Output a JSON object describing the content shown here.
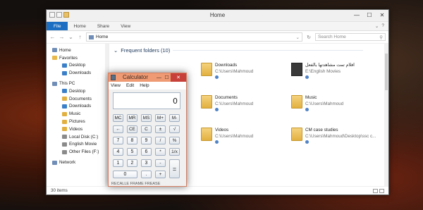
{
  "explorer": {
    "title": "Home",
    "controls": {
      "minimize": "—",
      "maximize": "☐",
      "close": "✕"
    },
    "ribbon_tabs": [
      "File",
      "Home",
      "Share",
      "View"
    ],
    "ribbon_right": {
      "expand": "⌄",
      "help": "?"
    },
    "address": {
      "back": "←",
      "forward": "→",
      "recent": "⌄",
      "up": "↑",
      "path": "Home",
      "dropdown": "⌄",
      "refresh": "↻"
    },
    "search_placeholder": "Search Home",
    "nav": [
      {
        "label": "Home",
        "level": 1,
        "icon": "home-icon",
        "color": "#6f8db7"
      },
      {
        "label": "Favorites",
        "level": 1,
        "icon": "star-icon",
        "color": "#e8b84a"
      },
      {
        "label": "Desktop",
        "level": 2,
        "icon": "desktop-icon",
        "color": "#3a7fc8"
      },
      {
        "label": "Downloads",
        "level": 2,
        "icon": "downloads-icon",
        "color": "#3a7fc8"
      },
      {
        "label": "This PC",
        "level": 1,
        "icon": "computer-icon",
        "color": "#6f8db7"
      },
      {
        "label": "Desktop",
        "level": 2,
        "icon": "desktop-icon",
        "color": "#3a7fc8"
      },
      {
        "label": "Documents",
        "level": 2,
        "icon": "documents-icon",
        "color": "#e2b040"
      },
      {
        "label": "Downloads",
        "level": 2,
        "icon": "downloads-icon",
        "color": "#3a7fc8"
      },
      {
        "label": "Music",
        "level": 2,
        "icon": "music-icon",
        "color": "#e2b040"
      },
      {
        "label": "Pictures",
        "level": 2,
        "icon": "pictures-icon",
        "color": "#e2b040"
      },
      {
        "label": "Videos",
        "level": 2,
        "icon": "videos-icon",
        "color": "#e2b040"
      },
      {
        "label": "Local Disk (C:)",
        "level": 2,
        "icon": "drive-icon",
        "color": "#8a8a8a"
      },
      {
        "label": "English Movie",
        "level": 2,
        "icon": "drive-icon",
        "color": "#8a8a8a"
      },
      {
        "label": "Other Files (F:)",
        "level": 2,
        "icon": "drive-icon",
        "color": "#8a8a8a"
      },
      {
        "label": "Network",
        "level": 1,
        "icon": "network-icon",
        "color": "#6f8db7"
      }
    ],
    "section_title": "Frequent folders (10)",
    "folders": [
      {
        "name": "Downloads",
        "path": "C:\\Users\\Mahmoud"
      },
      {
        "name": "افلام تمت مشاهدتها بالفعل",
        "path": "E:\\English Movies"
      },
      {
        "name": "Documents",
        "path": "C:\\Users\\Mahmoud"
      },
      {
        "name": "Music",
        "path": "C:\\Users\\Mahmoud"
      },
      {
        "name": "Videos",
        "path": "C:\\Users\\Mahmoud"
      },
      {
        "name": "CM case studies",
        "path": "C:\\Users\\Mahmoud\\Desktop\\ssc c..."
      }
    ],
    "status": "30 items"
  },
  "calculator": {
    "title": "Calculator",
    "controls": {
      "minimize": "—",
      "maximize": "☐",
      "close": "✕"
    },
    "menu": [
      "View",
      "Edit",
      "Help"
    ],
    "display": "0",
    "keys": [
      "MC",
      "MR",
      "MS",
      "M+",
      "M-",
      "←",
      "CE",
      "C",
      "±",
      "√",
      "7",
      "8",
      "9",
      "/",
      "%",
      "4",
      "5",
      "6",
      "*",
      "1/x",
      "1",
      "2",
      "3",
      "-",
      "=",
      "0",
      ".",
      "+"
    ]
  },
  "partial_text_below_calculator": "RECALLE FRAME FREASE"
}
